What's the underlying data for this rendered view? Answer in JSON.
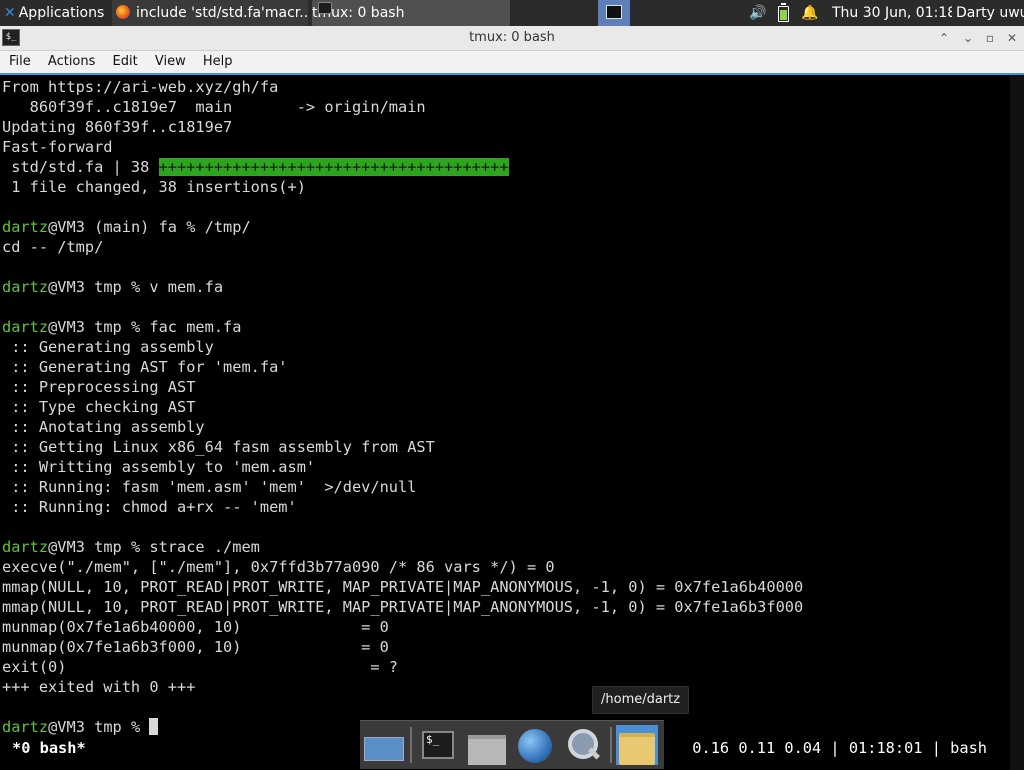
{
  "panel": {
    "applications_label": "Applications ≡",
    "tasks": [
      {
        "label": "include 'std/std.fa'macr..."
      },
      {
        "label": "tmux: 0 bash"
      }
    ],
    "clock": "Thu 30 Jun, 01:18",
    "user": "Darty uwu"
  },
  "window": {
    "title": "tmux: 0 bash",
    "menu": [
      "File",
      "Actions",
      "Edit",
      "View",
      "Help"
    ]
  },
  "terminal": {
    "prompt_user": "dartz",
    "lines": [
      {
        "text": "From https://ari-web.xyz/gh/fa"
      },
      {
        "text": "   860f39f..c1819e7  main       -> origin/main"
      },
      {
        "text": "Updating 860f39f..c1819e7"
      },
      {
        "text": "Fast-forward"
      },
      {
        "text": " std/std.fa | 38 ",
        "plus": "++++++++++++++++++++++++++++++++++++++"
      },
      {
        "text": " 1 file changed, 38 insertions(+)"
      },
      {
        "text": ""
      },
      {
        "prompt": true,
        "text": "@VM3 (main) fa % /tmp/"
      },
      {
        "text": "cd -- /tmp/"
      },
      {
        "text": ""
      },
      {
        "prompt": true,
        "text": "@VM3 tmp % v mem.fa"
      },
      {
        "text": ""
      },
      {
        "prompt": true,
        "text": "@VM3 tmp % fac mem.fa"
      },
      {
        "text": " :: Generating assembly"
      },
      {
        "text": " :: Generating AST for 'mem.fa'"
      },
      {
        "text": " :: Preprocessing AST"
      },
      {
        "text": " :: Type checking AST"
      },
      {
        "text": " :: Anotating assembly"
      },
      {
        "text": " :: Getting Linux x86_64 fasm assembly from AST"
      },
      {
        "text": " :: Writting assembly to 'mem.asm'"
      },
      {
        "text": " :: Running: fasm 'mem.asm' 'mem'  >/dev/null"
      },
      {
        "text": " :: Running: chmod a+rx -- 'mem'"
      },
      {
        "text": ""
      },
      {
        "prompt": true,
        "text": "@VM3 tmp % strace ./mem"
      },
      {
        "text": "execve(\"./mem\", [\"./mem\"], 0x7ffd3b77a090 /* 86 vars */) = 0"
      },
      {
        "text": "mmap(NULL, 10, PROT_READ|PROT_WRITE, MAP_PRIVATE|MAP_ANONYMOUS, -1, 0) = 0x7fe1a6b40000"
      },
      {
        "text": "mmap(NULL, 10, PROT_READ|PROT_WRITE, MAP_PRIVATE|MAP_ANONYMOUS, -1, 0) = 0x7fe1a6b3f000"
      },
      {
        "text": "munmap(0x7fe1a6b40000, 10)             = 0"
      },
      {
        "text": "munmap(0x7fe1a6b3f000, 10)             = 0"
      },
      {
        "text": "exit(0)                                 = ?"
      },
      {
        "text": "+++ exited with 0 +++"
      },
      {
        "text": ""
      },
      {
        "prompt": true,
        "text": "@VM3 tmp % ",
        "cursor": true
      }
    ],
    "status_left": "*0 bash*",
    "status_right": "0.16 0.11 0.04 | 01:18:01 | bash"
  },
  "tooltip": "/home/dartz",
  "colors": {
    "prompt_user": "#5fc43b",
    "plus_bg": "#2ea51f",
    "accent": "#4a90d9"
  }
}
